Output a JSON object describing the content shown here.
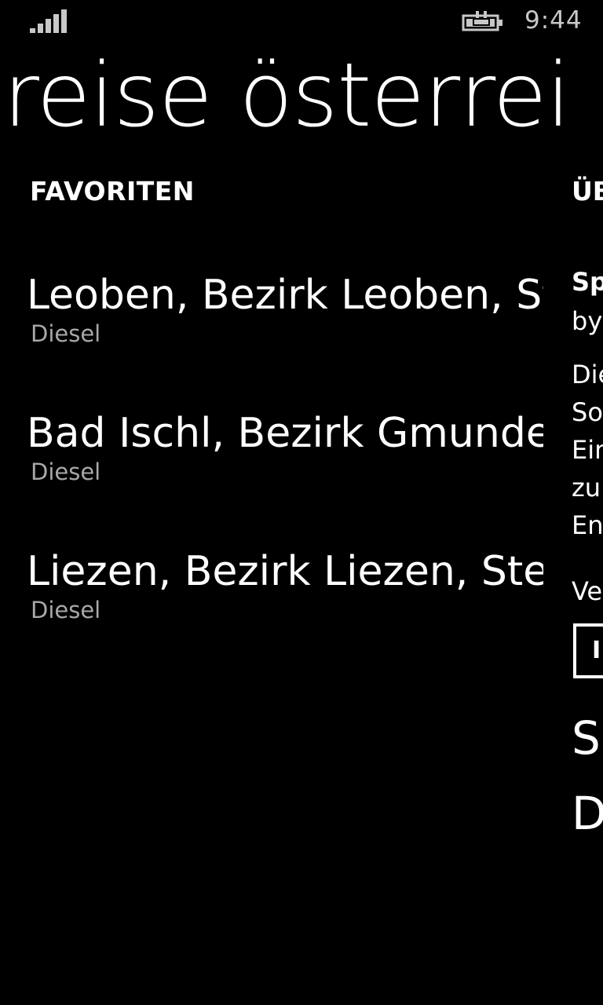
{
  "status_bar": {
    "time": "9:44",
    "signal_icon": "signal-strength-icon",
    "battery_icon": "battery-charging-icon"
  },
  "app": {
    "pivot_title": "reise österrei"
  },
  "favorites": {
    "header": "FAVORITEN",
    "items": [
      {
        "title": "Leoben, Bezirk Leoben, St",
        "fuel": "Diesel"
      },
      {
        "title": "Bad Ischl, Bezirk Gmunder",
        "fuel": "Diesel"
      },
      {
        "title": "Liezen, Bezirk Liezen, Steie",
        "fuel": "Diesel"
      }
    ]
  },
  "about_peek": {
    "header": "ÜB",
    "app_name": "Sp",
    "by": "by",
    "lines": [
      "Die",
      "So",
      "Ein",
      "zu",
      "Ent"
    ],
    "version": "Ve",
    "button": "I",
    "link1": "Su",
    "link2": "D"
  }
}
